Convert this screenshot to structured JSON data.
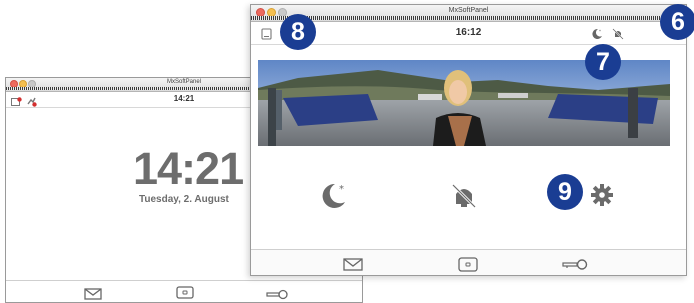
{
  "back_window": {
    "title": "MxSoftPanel",
    "time": "14:21",
    "clock": {
      "time": "14:21",
      "date": "Tuesday, 2. August"
    }
  },
  "front_window": {
    "title": "MxSoftPanel",
    "time": "16:12"
  },
  "callouts": {
    "badge_6": "6",
    "badge_7": "7",
    "badge_8": "8",
    "badge_9": "9"
  },
  "colors": {
    "badge": "#1a3d93",
    "icon": "#6b6b6b",
    "alert": "#d32f2f"
  },
  "icons": {
    "back_toolbar": [
      "message-alert-icon",
      "missed-call-icon"
    ],
    "front_toolbar": [
      "screen-icon",
      "night-mode-icon",
      "mute-icon"
    ],
    "controls": [
      "night-mode-icon",
      "mute-icon",
      "settings-gear-icon"
    ],
    "bottom": [
      "mail-icon",
      "camera-view-icon",
      "key-door-open-icon"
    ]
  }
}
